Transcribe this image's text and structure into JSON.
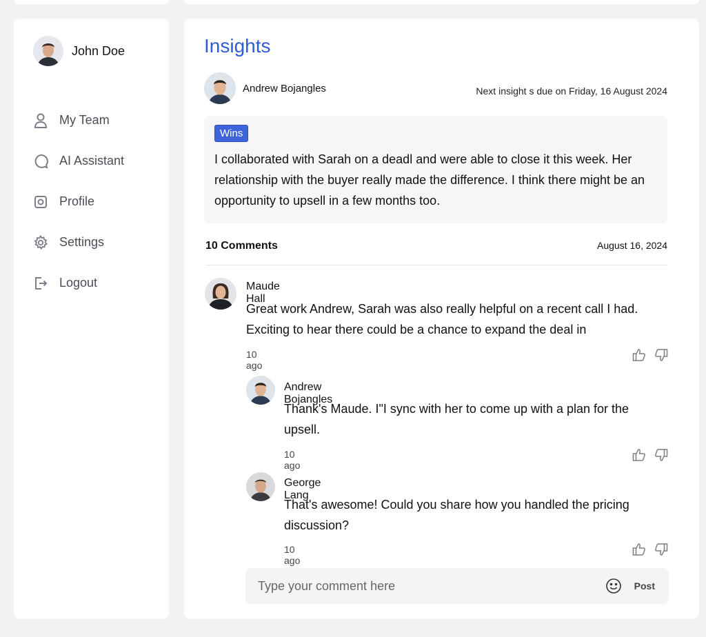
{
  "user": {
    "name": "John Doe"
  },
  "sidebar": {
    "items": [
      {
        "label": "My Team",
        "icon": "person-icon"
      },
      {
        "label": "AI Assistant",
        "icon": "chat-bubble-icon"
      },
      {
        "label": "Profile",
        "icon": "profile-icon"
      },
      {
        "label": "Settings",
        "icon": "gear-icon"
      },
      {
        "label": "Logout",
        "icon": "logout-icon"
      }
    ]
  },
  "main": {
    "title": "Insights",
    "author": "Andrew Bojangles",
    "due": "Next insight s due on Friday, 16 August 2024",
    "insight": {
      "tag": "Wins",
      "text": "I collaborated with Sarah on a deadl and were able to close it this week. Her relationship with the buyer really made the difference. I think there might be an opportunity to upsell in a few months too."
    },
    "comments_header": {
      "count": "10 Comments",
      "date": "August 16, 2024"
    },
    "comments": [
      {
        "name": "Maude Hall",
        "text": "Great work Andrew, Sarah was also really helpful on a recent call I had. Exciting to hear there could be a chance to expand the deal in",
        "ago": "10 ago"
      },
      {
        "name": "Andrew Bojangles",
        "text": "Thank's Maude. I\"I sync with her to come up with a plan for the upsell.",
        "ago": "10 ago"
      },
      {
        "name": "George Lang",
        "text": "That's awesome! Could you share how you handled the pricing discussion?",
        "ago": "10 ago"
      }
    ],
    "input": {
      "placeholder": "Type your comment here",
      "post_label": "Post"
    }
  },
  "colors": {
    "accent": "#2f5bd8",
    "tag": "#3f63d8",
    "muted": "#4a4d56"
  }
}
